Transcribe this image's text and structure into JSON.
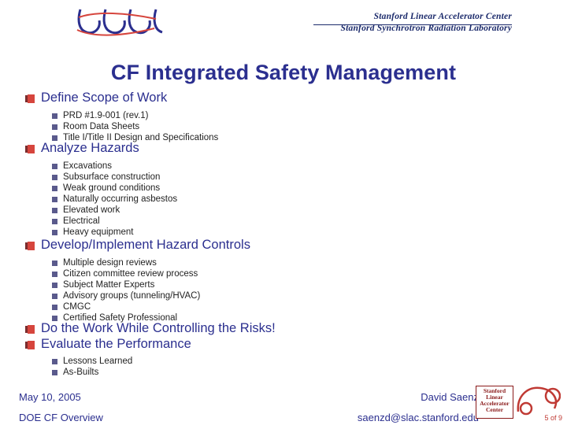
{
  "header": {
    "logo_name": "LCLS",
    "org_line1": "Stanford Linear Accelerator Center",
    "org_line2": "Stanford Synchrotron Radiation Laboratory"
  },
  "slide": {
    "title": "CF Integrated Safety Management",
    "sections": [
      {
        "heading": "Define Scope of Work",
        "items": [
          "PRD #1.9-001 (rev.1)",
          "Room Data Sheets",
          "Title I/Title II Design and Specifications"
        ]
      },
      {
        "heading": "Analyze Hazards",
        "items": [
          "Excavations",
          "Subsurface construction",
          "Weak ground conditions",
          "Naturally occurring asbestos",
          "Elevated work",
          "Electrical",
          "Heavy equipment"
        ]
      },
      {
        "heading": "Develop/Implement Hazard Controls",
        "items": [
          "Multiple design reviews",
          "Citizen committee review process",
          "Subject Matter Experts",
          "Advisory groups (tunneling/HVAC)",
          "CMGC",
          "Certified Safety Professional"
        ]
      },
      {
        "heading": "Do the Work While Controlling the Risks!",
        "items": []
      },
      {
        "heading": "Evaluate the Performance",
        "items": [
          "Lessons Learned",
          "As-Builts"
        ]
      }
    ]
  },
  "footer": {
    "date": "May 10, 2005",
    "deck": "DOE CF Overview",
    "author": "David Saenz",
    "email": "saenzd@slac.stanford.edu",
    "badge_lines": [
      "Stanford",
      "Linear",
      "Accelerator",
      "Center"
    ],
    "page_number": "5 of 9"
  },
  "colors": {
    "title_blue": "#2b2f8f",
    "bullet_red": "#d6453d",
    "bullet_shadow": "#7b2d2d",
    "sub_bullet": "#5a5a8c",
    "body_text": "#222222",
    "badge_red": "#8a1a1a"
  }
}
